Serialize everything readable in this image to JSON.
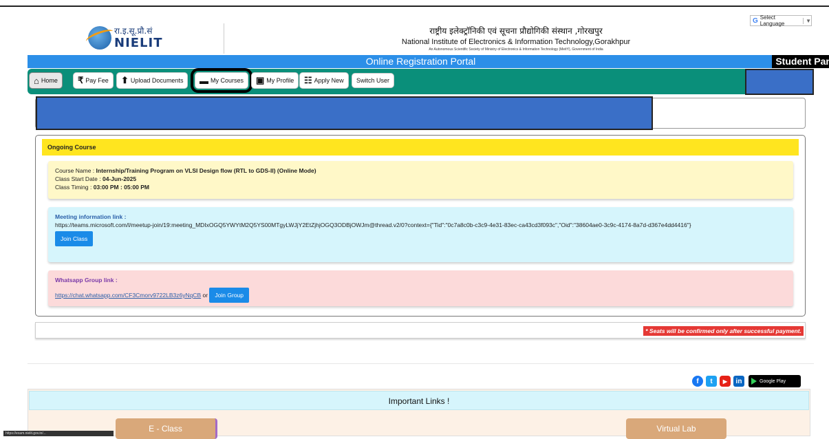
{
  "header": {
    "logo_hindi": "रा.इ.सू.प्रौ.सं",
    "logo_name": "NIELIT",
    "inst_hindi": "राष्ट्रीय इलेक्ट्रॉनिकी एवं सूचना प्रौद्योगिकी संस्थान ,गोरखपुर",
    "inst_en": "National Institute of Electronics & Information Technology,Gorakhpur",
    "inst_sub": "An Autonomous Scientific Society of Ministry of Electronics & Information Technology (MeitY), Government of India",
    "language_select": "Select Language"
  },
  "portal_title": "Online Registration Portal",
  "panel_label": "Student Panel",
  "nav": {
    "home": "Home",
    "pay_fee": "Pay Fee",
    "upload": "Upload Documents",
    "courses": "My Courses",
    "profile": "My Profile",
    "apply": "Apply New",
    "switch": "Switch User"
  },
  "ongoing": {
    "heading": "Ongoing Course",
    "course_name_label": "Course Name : ",
    "course_name": "Internship/Training Program on VLSI Design flow (RTL to GDS-II) (Online Mode)",
    "start_label": "Class Start Date : ",
    "start_date": "04-Jun-2025",
    "timing_label": "Class Timing : ",
    "timing": "03:00 PM : 05:00 PM"
  },
  "meeting": {
    "title": "Meeting information link :",
    "url": "https://teams.microsoft.com/l/meetup-join/19:meeting_MDIxOGQ5YWYtM2Q5YS00MTgyLWJjY2EtZjhjOGQ3ODBjOWJm@thread.v2/0?context={\"Tid\":\"0c7a8c0b-c3c9-4e31-83ec-ca43cd3f093c\",\"Oid\":\"38604ae0-3c9c-4174-8a7d-d367e4dd4416\"}",
    "button": "Join Class"
  },
  "whatsapp": {
    "title": "Whatsapp Group link :",
    "url": "https://chat.whatsapp.com/CF3Cmorv9722LB3z6yNqCB",
    "or": " or ",
    "button": "Join Group"
  },
  "seat_note": "* Seats will be confirmed only after successful payment.",
  "store_label": "Google Play",
  "important_links": "Important Links !",
  "link_eclass": "E - Class",
  "link_vlab": "Virtual Lab",
  "status_url": "https://exam.nielit.gov.in/..."
}
